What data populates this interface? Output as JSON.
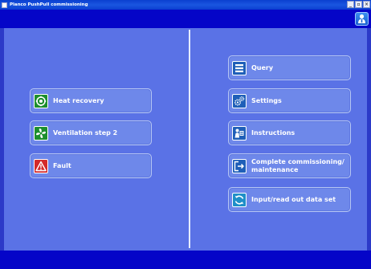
{
  "window": {
    "title": "Planco PushPull commissioning",
    "controls": [
      "_",
      "▫",
      "×"
    ]
  },
  "left_menu": [
    {
      "label": "Heat recovery",
      "icon": "heat-recovery-icon"
    },
    {
      "label": "Ventilation step 2",
      "icon": "fan-icon"
    },
    {
      "label": "Fault",
      "icon": "warning-icon"
    }
  ],
  "right_menu": [
    {
      "label": "Query",
      "icon": "list-icon"
    },
    {
      "label": "Settings",
      "icon": "gears-icon"
    },
    {
      "label": "Instructions",
      "icon": "instructions-icon"
    },
    {
      "label": "Complete commissioning/\nmaintenance",
      "icon": "exit-icon"
    },
    {
      "label": "Input/read out data set",
      "icon": "refresh-icon"
    }
  ],
  "colors": {
    "background": "#2c3ac8",
    "panel": "#5a72e6",
    "button": "#6e88ea",
    "bar": "#0505c8"
  }
}
